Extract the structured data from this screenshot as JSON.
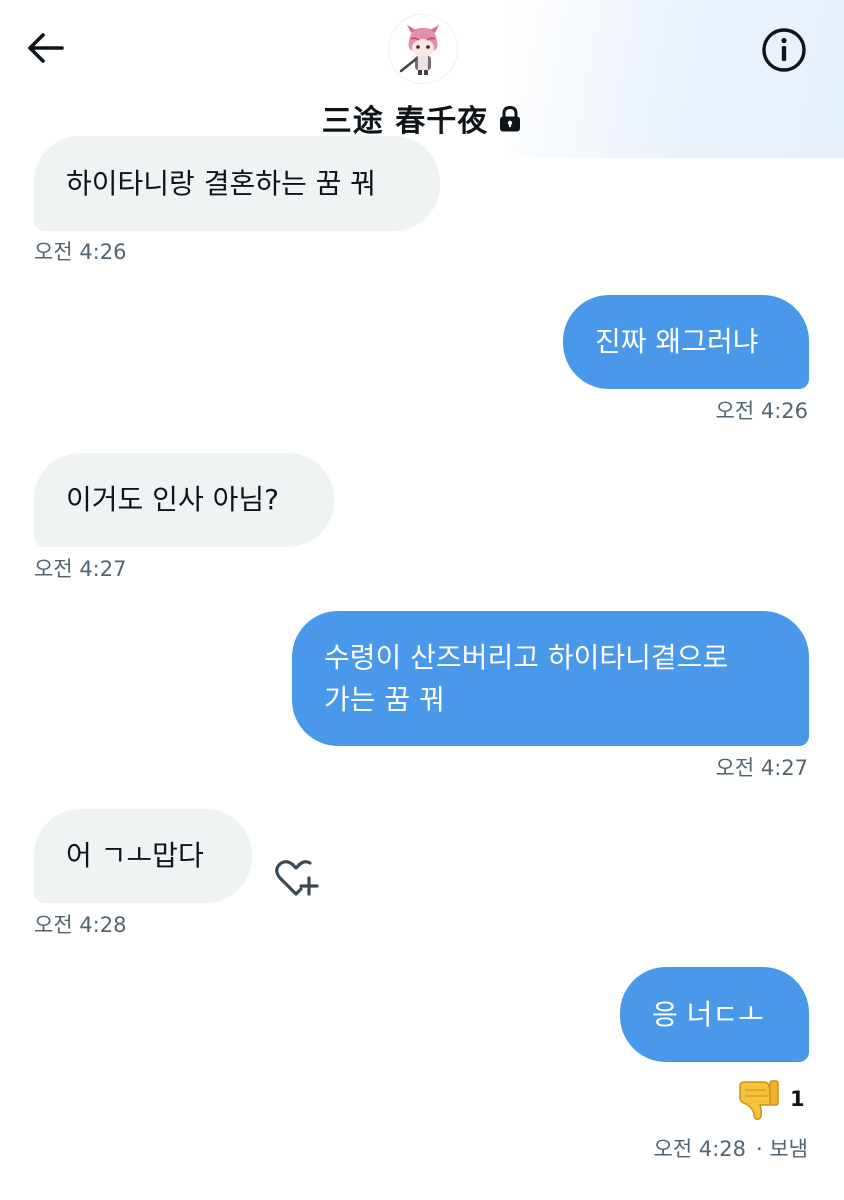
{
  "header": {
    "title": "三途 春千夜",
    "back_icon": "arrow-left-icon",
    "info_icon": "info-circle-icon",
    "lock_icon": "lock-icon"
  },
  "colors": {
    "outgoing_bubble": "#4a98e9",
    "incoming_bubble": "#eff3f4",
    "timestamp": "#536471"
  },
  "messages": [
    {
      "direction": "incoming",
      "text": "하이타니랑 결혼하는 꿈 꿔",
      "time": "오전 4:26"
    },
    {
      "direction": "outgoing",
      "text": "진짜 왜그러냐",
      "time": "오전 4:26"
    },
    {
      "direction": "incoming",
      "text": "이거도 인사 아님?",
      "time": "오전 4:27"
    },
    {
      "direction": "outgoing",
      "lines": [
        "수령이 산즈버리고 하이타니곁으로",
        "가는 꿈 꿔"
      ],
      "time": "오전 4:27"
    },
    {
      "direction": "incoming",
      "text": "어 ㄱㅗ맙다",
      "time": "오전 4:28",
      "action_icon": "heart-plus-icon"
    },
    {
      "direction": "outgoing",
      "text": "응 너ㄷㅗ",
      "time": "오전 4:28",
      "status": "· 보냄",
      "reaction": {
        "emoji": "thumbs-down-emoji",
        "count": "1"
      }
    }
  ]
}
